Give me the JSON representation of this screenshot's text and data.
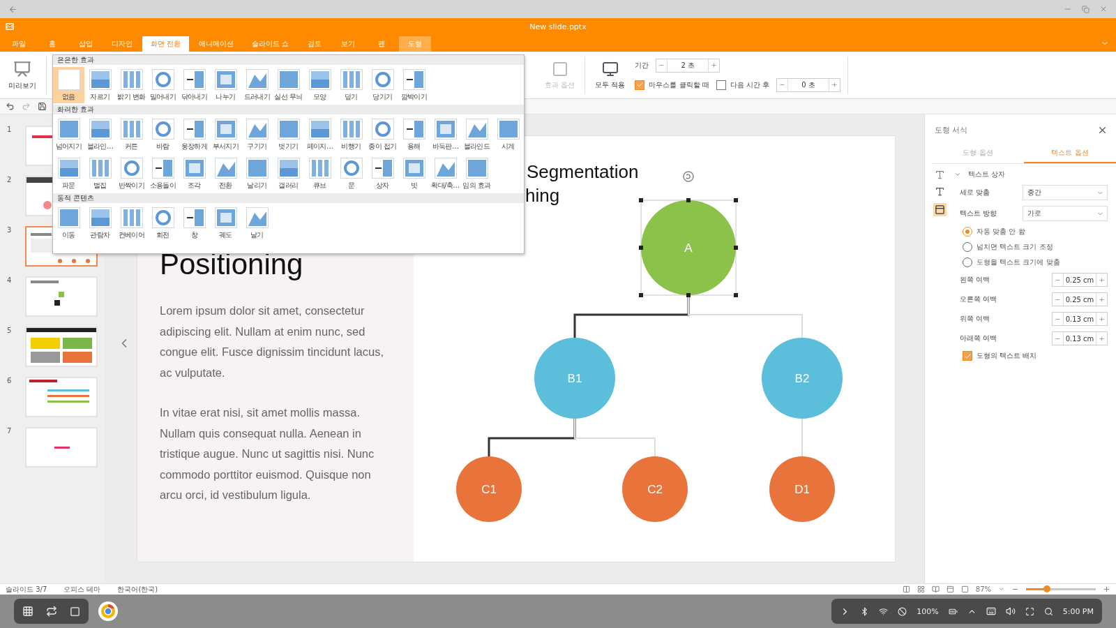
{
  "window": {
    "title": "New slide.pptx"
  },
  "menu_tabs": [
    {
      "label": "파일",
      "selected": false,
      "contextual": false
    },
    {
      "label": "홈",
      "selected": false,
      "contextual": false
    },
    {
      "label": "삽입",
      "selected": false,
      "contextual": false
    },
    {
      "label": "디자인",
      "selected": false,
      "contextual": false
    },
    {
      "label": "화면 전환",
      "selected": true,
      "contextual": false
    },
    {
      "label": "애니메이션",
      "selected": false,
      "contextual": false
    },
    {
      "label": "슬라이드 쇼",
      "selected": false,
      "contextual": false
    },
    {
      "label": "검토",
      "selected": false,
      "contextual": false
    },
    {
      "label": "보기",
      "selected": false,
      "contextual": false
    },
    {
      "label": "펜",
      "selected": false,
      "contextual": false
    },
    {
      "label": "도형",
      "selected": false,
      "contextual": true
    }
  ],
  "ribbon": {
    "preview": "미리보기",
    "effect_options": {
      "label": "효과 옵션",
      "disabled": true
    },
    "apply_all": "모두 적용",
    "duration": {
      "label": "기간",
      "value": "2 초"
    },
    "on_click": {
      "label": "마우스를 클릭할 때",
      "checked": true
    },
    "after_time": {
      "label": "다음 시간 후",
      "checked": false,
      "value": "0 초"
    }
  },
  "transition_gallery": {
    "sections": [
      {
        "title": "은은한 효과",
        "items": [
          {
            "label": "없음",
            "selected": true
          },
          {
            "label": "자르기",
            "selected": false
          },
          {
            "label": "밝기 변화",
            "selected": false
          },
          {
            "label": "밀어내기",
            "selected": false
          },
          {
            "label": "닦아내기",
            "selected": false
          },
          {
            "label": "나누기",
            "selected": false
          },
          {
            "label": "드러내기",
            "selected": false
          },
          {
            "label": "실선 무늬",
            "selected": false
          },
          {
            "label": "모양",
            "selected": false
          },
          {
            "label": "덮기",
            "selected": false
          },
          {
            "label": "당기기",
            "selected": false
          },
          {
            "label": "깜박이기",
            "selected": false
          }
        ]
      },
      {
        "title": "화려한 효과",
        "items": [
          {
            "label": "넘어지기",
            "selected": false
          },
          {
            "label": "블라인…",
            "selected": false
          },
          {
            "label": "커튼",
            "selected": false
          },
          {
            "label": "바람",
            "selected": false
          },
          {
            "label": "웅장하게",
            "selected": false
          },
          {
            "label": "부서지기",
            "selected": false
          },
          {
            "label": "구기기",
            "selected": false
          },
          {
            "label": "벗기기",
            "selected": false
          },
          {
            "label": "페이지…",
            "selected": false
          },
          {
            "label": "비행기",
            "selected": false
          },
          {
            "label": "종이 접기",
            "selected": false
          },
          {
            "label": "용해",
            "selected": false
          },
          {
            "label": "바둑판…",
            "selected": false
          },
          {
            "label": "블라인드",
            "selected": false
          },
          {
            "label": "시계",
            "selected": false
          },
          {
            "label": "파문",
            "selected": false
          },
          {
            "label": "벌집",
            "selected": false
          },
          {
            "label": "반짝이기",
            "selected": false
          },
          {
            "label": "소용돌이",
            "selected": false
          },
          {
            "label": "조각",
            "selected": false
          },
          {
            "label": "전환",
            "selected": false
          },
          {
            "label": "날리기",
            "selected": false
          },
          {
            "label": "갤러리",
            "selected": false
          },
          {
            "label": "큐브",
            "selected": false
          },
          {
            "label": "문",
            "selected": false
          },
          {
            "label": "상자",
            "selected": false
          },
          {
            "label": "빗",
            "selected": false
          },
          {
            "label": "확대/축…",
            "selected": false
          },
          {
            "label": "임의 효과",
            "selected": false
          }
        ]
      },
      {
        "title": "동적 콘텐츠",
        "items": [
          {
            "label": "이동",
            "selected": false
          },
          {
            "label": "관람차",
            "selected": false
          },
          {
            "label": "컨베이어",
            "selected": false
          },
          {
            "label": "회전",
            "selected": false
          },
          {
            "label": "창",
            "selected": false
          },
          {
            "label": "궤도",
            "selected": false
          },
          {
            "label": "날기",
            "selected": false
          }
        ]
      }
    ]
  },
  "slides": [
    {
      "number": "1",
      "selected": false
    },
    {
      "number": "2",
      "selected": false
    },
    {
      "number": "3",
      "selected": true
    },
    {
      "number": "4",
      "selected": false
    },
    {
      "number": "5",
      "selected": false
    },
    {
      "number": "6",
      "selected": false
    },
    {
      "number": "7",
      "selected": false
    }
  ],
  "slide": {
    "title_fragments": [
      "Segmentation",
      "hing",
      "Positioning"
    ],
    "paragraphs": [
      "Lorem ipsum dolor sit amet, consectetur adipiscing elit. Nullam at enim nunc, sed congue elit. Fusce dignissim tincidunt lacus, ac vulputate.",
      "In vitae erat nisi, sit amet mollis massa. Nullam quis consequat nulla. Aenean in tristique augue. Nunc ut sagittis nisi. Nunc commodo porttitor euismod. Quisque non arcu orci, id vestibulum ligula."
    ],
    "tree": {
      "label": "A",
      "color": "#8bc34a",
      "selected": true,
      "children": [
        {
          "label": "B1",
          "color": "#5bbfdc",
          "selected": false,
          "emphasized_link": true,
          "children": [
            {
              "label": "C1",
              "color": "#e8743b",
              "selected": false,
              "emphasized_link": true
            },
            {
              "label": "C2",
              "color": "#e8743b",
              "selected": false,
              "emphasized_link": false
            }
          ]
        },
        {
          "label": "B2",
          "color": "#5bbfdc",
          "selected": false,
          "emphasized_link": false,
          "children": [
            {
              "label": "D1",
              "color": "#e8743b",
              "selected": false,
              "emphasized_link": false
            }
          ]
        }
      ]
    }
  },
  "format_panel": {
    "title": "도형 서식",
    "tabs": [
      {
        "label": "도형 옵션",
        "selected": false
      },
      {
        "label": "텍스트 옵션",
        "selected": true
      }
    ],
    "section": "텍스트 상자",
    "selects": [
      {
        "label": "세로 맞춤",
        "value": "중간"
      },
      {
        "label": "텍스트 방향",
        "value": "가로"
      }
    ],
    "autofit": [
      {
        "label": "자동 맞춤 안 함",
        "selected": true
      },
      {
        "label": "넘치면 텍스트 크기 조정",
        "selected": false
      },
      {
        "label": "도형을 텍스트 크기에 맞춤",
        "selected": false
      }
    ],
    "margins": [
      {
        "label": "왼쪽 여백",
        "value": "0.25 cm"
      },
      {
        "label": "오른쪽 여백",
        "value": "0.25 cm"
      },
      {
        "label": "위쪽 여백",
        "value": "0.13 cm"
      },
      {
        "label": "아래쪽 여백",
        "value": "0.13 cm"
      }
    ],
    "wrap": {
      "label": "도형의 텍스트 배치",
      "checked": true
    }
  },
  "status_bar": {
    "items": [
      "슬라이드 3/7",
      "오피스 테마",
      "한국어(한국)"
    ],
    "zoom": "87%",
    "zoom_level": {
      "level": 0.3
    }
  },
  "taskbar": {
    "battery": "100%",
    "time": "5:00 PM"
  }
}
